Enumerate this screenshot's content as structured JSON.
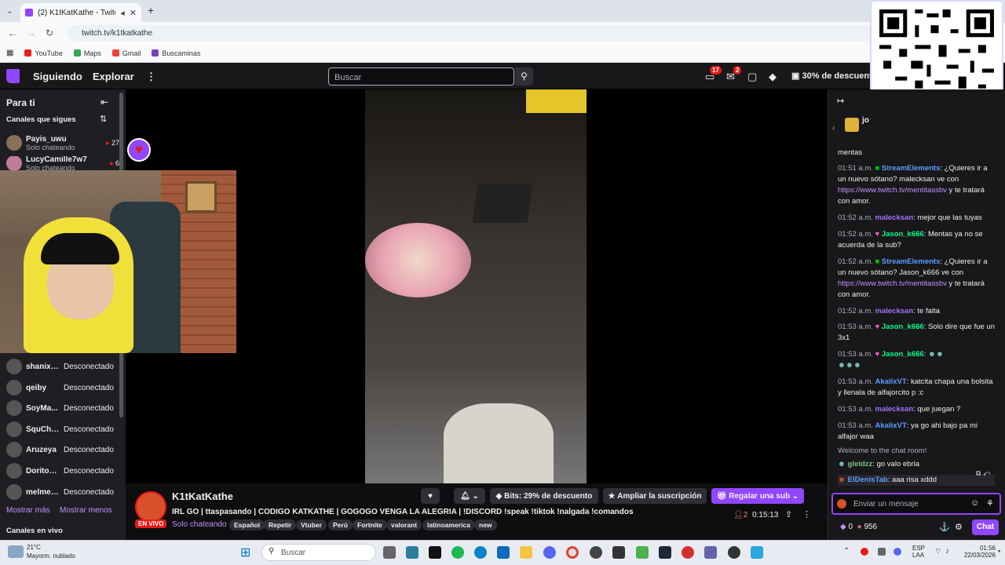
{
  "browser": {
    "tab_title": "(2) K1tKatKathe - Twitch",
    "url": "twitch.tv/k1tkatkathe",
    "bookmarks": [
      "YouTube",
      "Maps",
      "Gmail",
      "Buscaminas"
    ]
  },
  "topnav": {
    "following": "Siguiendo",
    "explore": "Explorar",
    "search_placeholder": "Buscar",
    "notif_count": "17",
    "whisper_count": "2",
    "discount": "30% de descuento"
  },
  "sidebar": {
    "title": "Para ti",
    "followed_header": "Canales que sigues",
    "live_channels": [
      {
        "name": "Payis_uwu",
        "status": "Solo chateando",
        "viewers": "27"
      },
      {
        "name": "LucyCamille7w7",
        "status": "Solo chateando",
        "viewers": "6"
      }
    ],
    "offline_channels": [
      {
        "name": "shanix_...",
        "status": "Desconectado"
      },
      {
        "name": "qeiby",
        "status": "Desconectado"
      },
      {
        "name": "SoyMa...",
        "status": "Desconectado"
      },
      {
        "name": "SquChan",
        "status": "Desconectado"
      },
      {
        "name": "Aruzeya",
        "status": "Desconectado"
      },
      {
        "name": "Doritoo...",
        "status": "Desconectado"
      },
      {
        "name": "melmelvt",
        "status": "Desconectado"
      }
    ],
    "show_more": "Mostrar más",
    "show_less": "Mostrar menos",
    "live_header": "Canales en vivo"
  },
  "channel": {
    "name": "K1tKatKathe",
    "live_badge": "EN VIVO",
    "title": "IRL GO | ttaspasando | CODIGO KATKATHE | GOGOGO VENGA LA ALEGRIA | !DISCORD !speak !tiktok !nalgada !comandos !speak",
    "category": "Solo chateando",
    "tags": [
      "Español",
      "Repetir",
      "Vtuber",
      "Perú",
      "Fortnite",
      "valorant",
      "latinoamerica",
      "new"
    ],
    "bits_label": "Bits: 29% de descuento",
    "extend_sub": "Ampliar la suscripción",
    "gift_sub": "Regalar una sub",
    "viewers": "2",
    "uptime": "0:15:13"
  },
  "chat": {
    "header_user": "jo",
    "messages": [
      {
        "time": "",
        "user": "",
        "color": "#efeff1",
        "text": "mentas"
      },
      {
        "time": "01:51 a.m.",
        "user": "StreamElements",
        "color": "#5c9dff",
        "text": ": ¿Quieres ir a un nuevo sótano? malecksan ve con",
        "link": "https://www.twitch.tv/mentitassbv",
        "after": " y te tratará con amor."
      },
      {
        "time": "01:52 a.m.",
        "user": "malecksan",
        "color": "#a970ff",
        "text": ": mejor que las tuyas"
      },
      {
        "time": "01:52 a.m.",
        "user": "Jason_k666",
        "color": "#00ff7f",
        "text": ": Mentas ya no se acuerda de la sub?"
      },
      {
        "time": "01:52 a.m.",
        "user": "StreamElements",
        "color": "#5c9dff",
        "text": ": ¿Quieres ir a un nuevo sótano? Jason_k666 ve con",
        "link": "https://www.twitch.tv/mentitassbv",
        "after": " y te tratará con amor."
      },
      {
        "time": "01:52 a.m.",
        "user": "malecksan",
        "color": "#a970ff",
        "text": ": te falta"
      },
      {
        "time": "01:53 a.m.",
        "user": "Jason_k666",
        "color": "#00ff7f",
        "text": ": Solo dire que fue un 3x1"
      },
      {
        "time": "01:53 a.m.",
        "user": "Jason_k666",
        "color": "#00ff7f",
        "text": ":"
      },
      {
        "time": "01:53 a.m.",
        "user": "AkalixVT",
        "color": "#5c9dff",
        "text": ": katcita chapa una bolsita y llenala de alfajorcito p :c"
      },
      {
        "time": "01:53 a.m.",
        "user": "malecksan",
        "color": "#a970ff",
        "text": ": que juegan ?"
      },
      {
        "time": "01:53 a.m.",
        "user": "AkalixVT",
        "color": "#5c9dff",
        "text": ": ya go ahi bajo pa mi alfajor waa"
      }
    ],
    "welcome": "Welcome to the chat room!",
    "recent": [
      {
        "user": "gleidzz",
        "color": "#7fbf7f",
        "text": ": go valo ebria"
      },
      {
        "user": "ElDenisTab",
        "color": "#5c9dff",
        "text": ": aaa risa xddd"
      }
    ],
    "input_placeholder": "Enviar un mensaje",
    "points_a": "0",
    "points_b": "956",
    "chat_button": "Chat"
  },
  "taskbar": {
    "weather_temp": "21°C",
    "weather_desc": "Mayorm. nublado",
    "search": "Buscar",
    "lang": "ESP",
    "lang2": "LAA",
    "time": "01:56",
    "date": "22/03/2026"
  }
}
